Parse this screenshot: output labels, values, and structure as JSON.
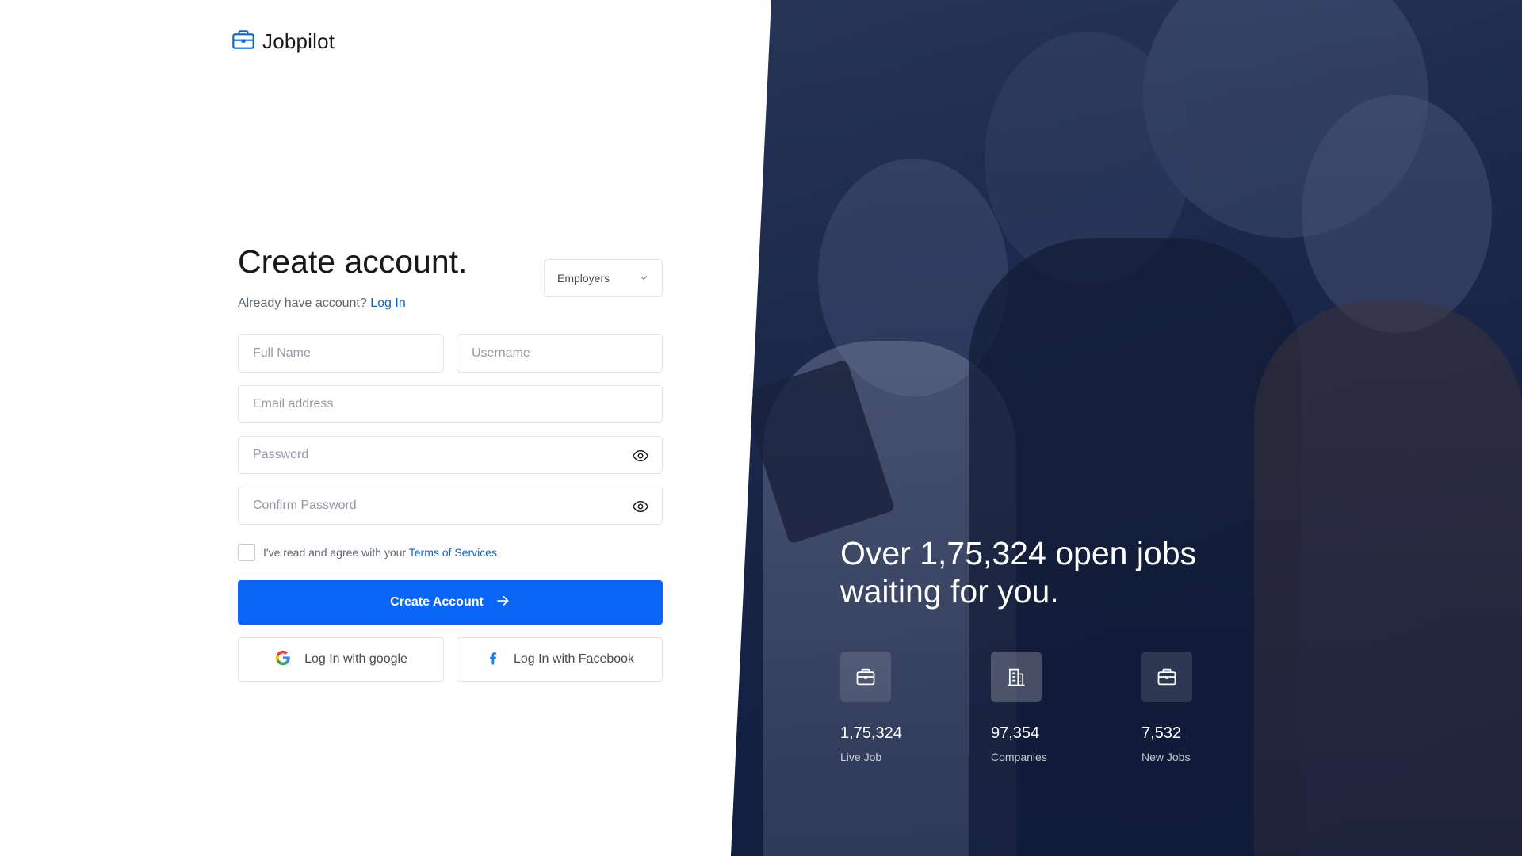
{
  "brand": {
    "name": "Jobpilot",
    "accent": "#0a65cc",
    "button_color": "#0a65f7"
  },
  "form": {
    "title": "Create account.",
    "subtitle_prefix": "Already have account?",
    "login_link": "Log In",
    "account_type": {
      "selected": "Employers"
    },
    "fields": {
      "full_name": {
        "placeholder": "Full Name",
        "value": ""
      },
      "username": {
        "placeholder": "Username",
        "value": ""
      },
      "email": {
        "placeholder": "Email address",
        "value": ""
      },
      "password": {
        "placeholder": "Password",
        "value": ""
      },
      "confirm_password": {
        "placeholder": "Confirm Password",
        "value": ""
      }
    },
    "terms_prefix": "I've read and agree with your",
    "terms_link": "Terms of Services",
    "terms_checked": false,
    "submit_label": "Create Account",
    "google_label": "Log In with google",
    "facebook_label": "Log In with Facebook"
  },
  "hero": {
    "headline": "Over 1,75,324 open jobs waiting for you.",
    "stats": [
      {
        "value": "1,75,324",
        "label": "Live Job",
        "icon": "briefcase-icon"
      },
      {
        "value": "97,354",
        "label": "Companies",
        "icon": "buildings-icon"
      },
      {
        "value": "7,532",
        "label": "New Jobs",
        "icon": "briefcase-icon"
      }
    ]
  },
  "icons": {
    "logo": "briefcase-icon",
    "select": "chevron-down-icon",
    "password_toggle": "eye-icon",
    "submit": "arrow-right-icon",
    "google": "google-icon",
    "facebook": "facebook-icon"
  }
}
